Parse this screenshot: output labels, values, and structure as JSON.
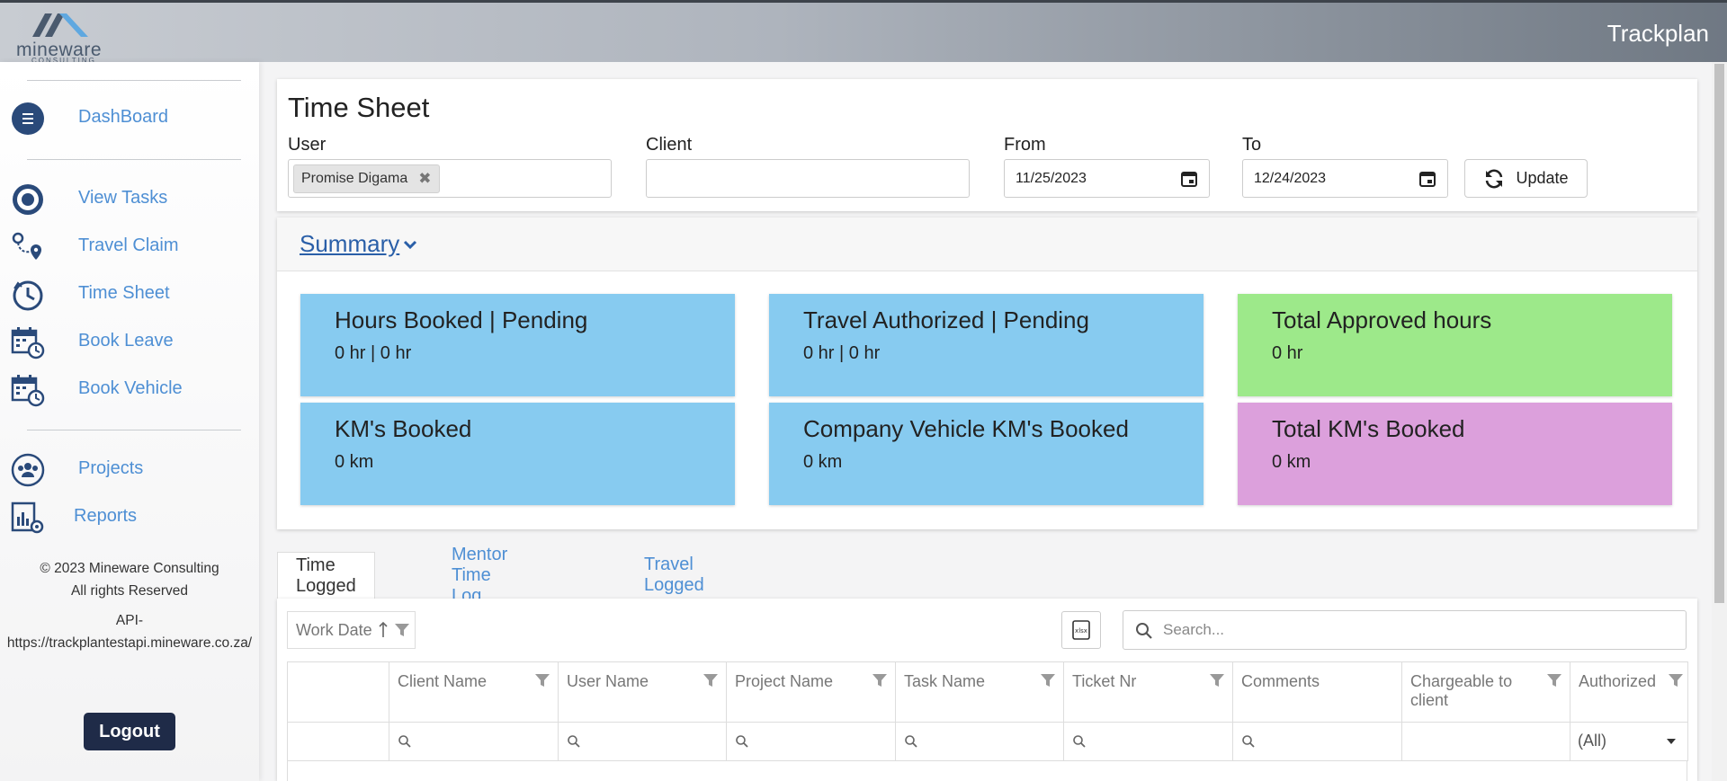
{
  "header": {
    "logo_text": "mineware",
    "logo_sub": "CONSULTING",
    "app_title": "Trackplan"
  },
  "sidebar": {
    "items": [
      {
        "label": "DashBoard",
        "icon": "menu-circle-icon"
      },
      {
        "label": "View Tasks",
        "icon": "target-icon"
      },
      {
        "label": "Travel Claim",
        "icon": "route-pin-icon"
      },
      {
        "label": "Time Sheet",
        "icon": "clock-icon"
      },
      {
        "label": "Book Leave",
        "icon": "calendar-clock-icon"
      },
      {
        "label": "Book Vehicle",
        "icon": "calendar-clock-icon"
      },
      {
        "label": "Projects",
        "icon": "team-icon"
      },
      {
        "label": "Reports",
        "icon": "report-gear-icon"
      }
    ],
    "copyright": "© 2023 Mineware Consulting",
    "rights": "All rights Reserved",
    "api_label": "API-",
    "api_url": "https://trackplantestapi.mineware.co.za/",
    "logout_label": "Logout"
  },
  "timesheet": {
    "title": "Time Sheet",
    "user_label": "User",
    "user_tag": "Promise Digama",
    "client_label": "Client",
    "client_value": "",
    "from_label": "From",
    "from_value": "11/25/2023",
    "to_label": "To",
    "to_value": "12/24/2023",
    "update_label": "Update"
  },
  "summary": {
    "heading": "Summary",
    "tiles": [
      {
        "title": "Hours Booked | Pending",
        "value": "0 hr | 0 hr",
        "color": "#87cbf0"
      },
      {
        "title": "Travel Authorized | Pending",
        "value": "0 hr | 0 hr",
        "color": "#87cbf0"
      },
      {
        "title": "Total Approved hours",
        "value": "0 hr",
        "color": "#9de98a"
      },
      {
        "title": "KM's Booked",
        "value": "0 km",
        "color": "#87cbf0"
      },
      {
        "title": "Company Vehicle KM's Booked",
        "value": "0 km",
        "color": "#87cbf0"
      },
      {
        "title": "Total KM's Booked",
        "value": "0 km",
        "color": "#dca0dc"
      }
    ]
  },
  "tabs": [
    {
      "label": "Time Logged",
      "active": true
    },
    {
      "label": "Mentor Time Log",
      "active": false
    },
    {
      "label": "Travel Logged",
      "active": false
    }
  ],
  "grid": {
    "sort_label": "Work Date",
    "search_placeholder": "Search...",
    "columns": [
      "",
      "Client Name",
      "User Name",
      "Project Name",
      "Task Name",
      "Ticket Nr",
      "Comments",
      "Chargeable to client",
      "Authorized"
    ],
    "authorized_filter": "(All)"
  },
  "colors": {
    "accent_link": "#4e8fd4",
    "nav_icon": "#2a4a7a",
    "logout_bg": "#1f2b48"
  }
}
